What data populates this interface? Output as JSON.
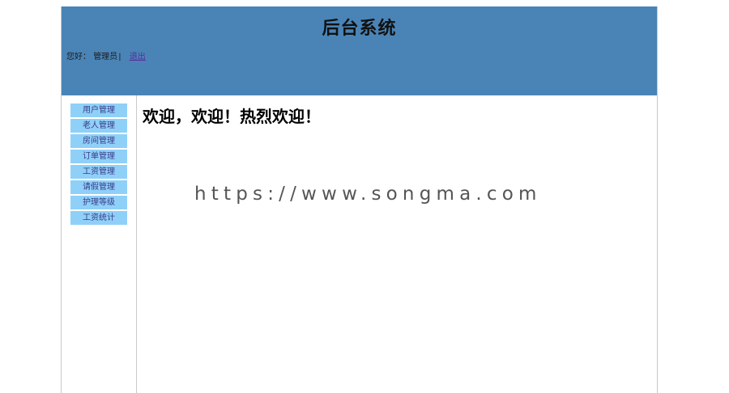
{
  "header": {
    "title": "后台系统",
    "greeting": "您好：",
    "username": "管理员",
    "separator": "|",
    "logout_label": "退出"
  },
  "sidebar": {
    "items": [
      {
        "label": "用户管理"
      },
      {
        "label": "老人管理"
      },
      {
        "label": "房间管理"
      },
      {
        "label": "订单管理"
      },
      {
        "label": "工资管理"
      },
      {
        "label": "请假管理"
      },
      {
        "label": "护理等级"
      },
      {
        "label": "工资统计"
      }
    ]
  },
  "main": {
    "welcome_text": "欢迎，欢迎！热烈欢迎！"
  },
  "watermark": {
    "text": "https://www.songma.com"
  },
  "colors": {
    "header_bg": "#4a84b6",
    "nav_item_bg": "#8fd0f8",
    "logout_link": "#5a2ca0"
  }
}
